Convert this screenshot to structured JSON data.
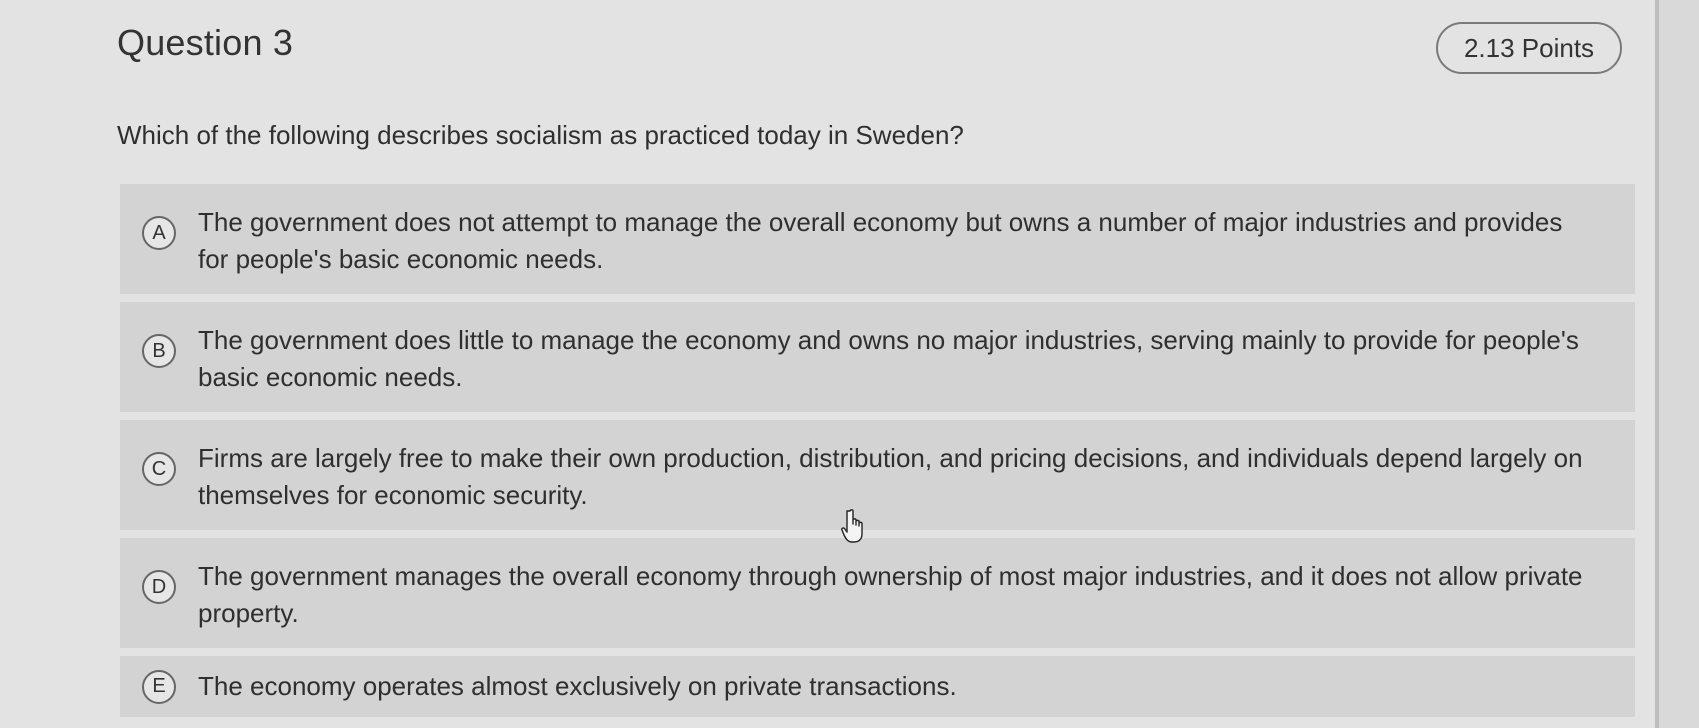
{
  "question": {
    "title": "Question 3",
    "points": "2.13 Points",
    "prompt": "Which of the following describes socialism as practiced today in Sweden?"
  },
  "options": [
    {
      "letter": "A",
      "text": "The government does not attempt to manage the overall economy but owns a number of major industries and provides for people's basic economic needs."
    },
    {
      "letter": "B",
      "text": "The government does little to manage the economy and owns no major industries, serving mainly to provide for people's basic economic needs."
    },
    {
      "letter": "C",
      "text": "Firms are largely free to make their own production, distribution, and pricing decisions, and individuals depend largely on themselves for economic security."
    },
    {
      "letter": "D",
      "text": "The government manages the overall economy through ownership of most major industries, and it does not allow private property."
    },
    {
      "letter": "E",
      "text": "The economy operates almost exclusively on private transactions."
    }
  ],
  "icons": {
    "cursor": "hand-pointer-icon"
  },
  "colors": {
    "background": "#e3e3e3",
    "option_background": "#d3d3d3",
    "text": "#2f2f2f"
  }
}
